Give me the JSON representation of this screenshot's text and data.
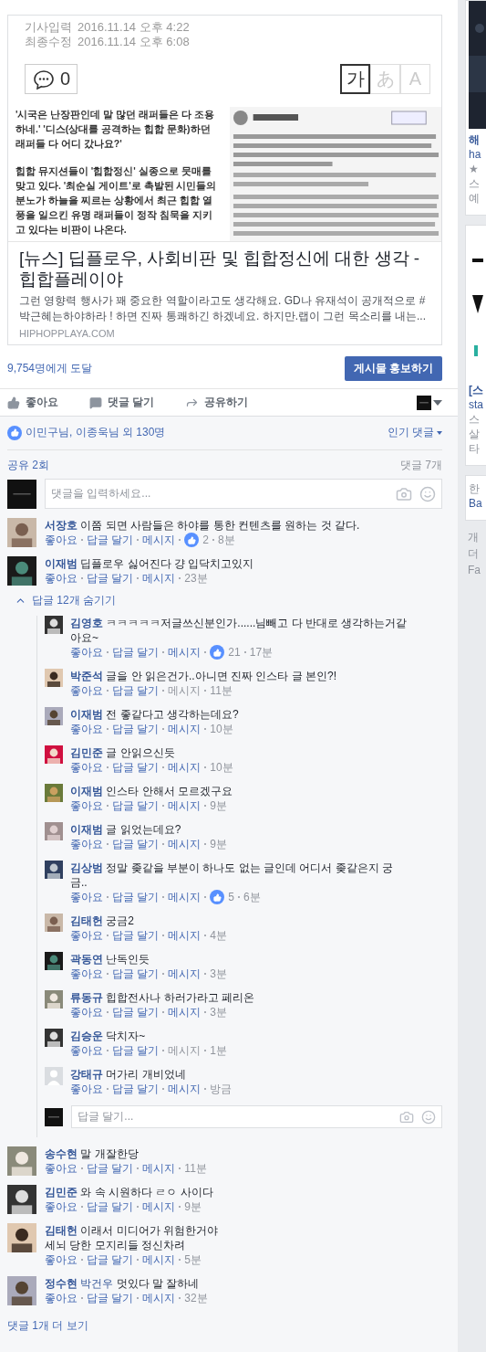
{
  "link_preview": {
    "article_dates": [
      {
        "label": "기사입력",
        "value": "2016.11.14 오후 4:22"
      },
      {
        "label": "최종수정",
        "value": "2016.11.14 오후 6:08"
      }
    ],
    "comment_count": "0",
    "font_options": [
      {
        "label": "가",
        "selected": true
      },
      {
        "label": "あ",
        "selected": false
      },
      {
        "label": "A",
        "selected": false
      }
    ],
    "article_text": [
      "'시국은 난장판인데 말 많던 래퍼들은 다 조용하네.' '디스(상대를 공격하는 힙합 문화)하던 래퍼들 다 어디 갔나요?'",
      "힙합 뮤지션들이 '힙합정신' 실종으로 뭇매를 맞고 있다. '최순실 게이트'로 촉발된 시민들의 분노가 하늘을 찌르는 상황에서 최근 힙합 열풍을 일으킨 유명 래퍼들이 정작 침묵을 지키고 있다는 비판이 나온다."
    ],
    "embedded_image": {
      "kind": "picture"
    },
    "title": "[뉴스] 딥플로우, 사회비판 및 힙합정신에 대한 생각 - 힙합플레이야",
    "description": "그런 영향력 행사가 꽤 중요한 역할이라고도 생각해요. GD나 유재석이 공개적으로 #박근혜는하야하라 ! 하면 진짜 통쾌하긴 하겠네요. 하지만.랩이 그런 목소리를 내는...",
    "domain": "HIPHOPPLAYA.COM"
  },
  "reach": "9,754명에게 도달",
  "promote_button": "게시물 홍보하기",
  "actions": [
    {
      "kind": "like",
      "label": "좋아요"
    },
    {
      "kind": "comment",
      "label": "댓글 달기"
    },
    {
      "kind": "share",
      "label": "공유하기"
    }
  ],
  "likes_summary": "이민구님, 이종욱님 외 130명",
  "sort": "인기 댓글",
  "shares": "공유 2회",
  "comment_total": "댓글 7개",
  "comment_placeholder": "댓글을 입력하세요...",
  "comments": [
    {
      "default_avatar": false,
      "actions": {
        "like": "좋아요",
        "reply": "답글 달기",
        "message": "메시지"
      },
      "name": "서장호",
      "text": "이쯤 되면 사람들은 하야를 통한 컨텐츠를 원하는 것 같다.",
      "message_enabled": true,
      "likes": "2",
      "time": "8분"
    },
    {
      "default_avatar": false,
      "actions": {
        "like": "좋아요",
        "reply": "답글 달기",
        "message": "메시지"
      },
      "name": "이재범",
      "text": "딥플로우 싫어진다 걍 입닥치고있지",
      "message_enabled": true,
      "time": "23분",
      "replies": {
        "toggle": "답글 12개 숨기기",
        "expanded": true,
        "placeholder": "답글 달기...",
        "items": [
          {
            "default_avatar": false,
            "actions": {
              "like": "좋아요",
              "reply": "답글 달기",
              "message": "메시지"
            },
            "name": "김영호",
            "text": "ㅋㅋㅋㅋㅋ저글쓰신분인가......님빼고 다 반대로 생각하는거같아요~",
            "message_enabled": true,
            "likes": "21",
            "time": "17분"
          },
          {
            "default_avatar": false,
            "actions": {
              "like": "좋아요",
              "reply": "답글 달기",
              "message": "메시지"
            },
            "name": "박준석",
            "text": "글을 안 읽은건가..아니면 진짜 인스타 글 본인?!",
            "message_enabled": false,
            "time": "11분"
          },
          {
            "default_avatar": false,
            "actions": {
              "like": "좋아요",
              "reply": "답글 달기",
              "message": "메시지"
            },
            "name": "이재범",
            "text": "전 좋같다고 생각하는데요?",
            "message_enabled": true,
            "time": "10분"
          },
          {
            "default_avatar": false,
            "actions": {
              "like": "좋아요",
              "reply": "답글 달기",
              "message": "메시지"
            },
            "name": "김민준",
            "text": "글 안읽으신듯",
            "message_enabled": true,
            "time": "10분"
          },
          {
            "default_avatar": false,
            "actions": {
              "like": "좋아요",
              "reply": "답글 달기",
              "message": "메시지"
            },
            "name": "이재범",
            "text": "인스타 안해서 모르겠구요",
            "message_enabled": true,
            "time": "9분"
          },
          {
            "default_avatar": false,
            "actions": {
              "like": "좋아요",
              "reply": "답글 달기",
              "message": "메시지"
            },
            "name": "이재범",
            "text": "글 읽었는데요?",
            "message_enabled": true,
            "time": "9분"
          },
          {
            "default_avatar": false,
            "actions": {
              "like": "좋아요",
              "reply": "답글 달기",
              "message": "메시지"
            },
            "name": "김상범",
            "text": "정말 좆같을 부분이 하나도 없는 글인데 어디서 좆같은지 궁금..",
            "message_enabled": true,
            "likes": "5",
            "time": "6분"
          },
          {
            "default_avatar": false,
            "actions": {
              "like": "좋아요",
              "reply": "답글 달기",
              "message": "메시지"
            },
            "name": "김태헌",
            "text": "궁금2",
            "message_enabled": true,
            "time": "4분"
          },
          {
            "default_avatar": false,
            "actions": {
              "like": "좋아요",
              "reply": "답글 달기",
              "message": "메시지"
            },
            "name": "곽동연",
            "text": "난독인듯",
            "message_enabled": true,
            "time": "3분"
          },
          {
            "default_avatar": false,
            "actions": {
              "like": "좋아요",
              "reply": "답글 달기",
              "message": "메시지"
            },
            "name": "류동규",
            "text": "힙합전사나 하러가라고 페리온",
            "message_enabled": true,
            "time": "3분"
          },
          {
            "default_avatar": false,
            "actions": {
              "like": "좋아요",
              "reply": "답글 달기",
              "message": "메시지"
            },
            "name": "김승운",
            "text": "닥치자~",
            "message_enabled": false,
            "time": "1분"
          },
          {
            "default_avatar": true,
            "actions": {
              "like": "좋아요",
              "reply": "답글 달기",
              "message": "메시지"
            },
            "name": "강태규",
            "text": "머가리 개비었네",
            "message_enabled": true,
            "time": "방금"
          }
        ]
      }
    },
    {
      "default_avatar": false,
      "actions": {
        "like": "좋아요",
        "reply": "답글 달기",
        "message": "메시지"
      },
      "name": "송수현",
      "text": "말 개잘한당",
      "message_enabled": true,
      "time": "11분"
    },
    {
      "default_avatar": false,
      "actions": {
        "like": "좋아요",
        "reply": "답글 달기",
        "message": "메시지"
      },
      "name": "김민준",
      "text": "와 속 시원하다 ㄹㅇ 사이다",
      "message_enabled": true,
      "time": "9분"
    },
    {
      "default_avatar": false,
      "actions": {
        "like": "좋아요",
        "reply": "답글 달기",
        "message": "메시지"
      },
      "name": "김태헌",
      "text": "이래서 미디어가 위험한거야\n세뇌 당한 모지리들 정신차려",
      "message_enabled": true,
      "time": "5분"
    },
    {
      "default_avatar": false,
      "actions": {
        "like": "좋아요",
        "reply": "답글 달기",
        "message": "메시지"
      },
      "name": "정수현",
      "tag": "박건우",
      "text": "멋있다 말 잘하네",
      "message_enabled": true,
      "time": "32분"
    }
  ],
  "more_comments": "댓글 1개 더 보기",
  "sidebar": {
    "cards": [
      {
        "texts": [
          {
            "kind": "title",
            "text": "해"
          },
          {
            "kind": "link",
            "text": "ha"
          },
          {
            "kind": "meta",
            "text": "★"
          },
          {
            "kind": "meta",
            "text": "스"
          },
          {
            "kind": "meta",
            "text": "예"
          }
        ]
      },
      {
        "texts": [
          {
            "kind": "title",
            "text": "[스"
          },
          {
            "kind": "link",
            "text": "sta"
          },
          {
            "kind": "meta",
            "text": "스"
          },
          {
            "kind": "meta",
            "text": "살"
          },
          {
            "kind": "meta",
            "text": "타"
          }
        ]
      },
      {
        "texts": [
          {
            "kind": "meta",
            "text": "한"
          },
          {
            "kind": "link",
            "text": "Ba"
          }
        ]
      }
    ],
    "footer": [
      "개",
      "더",
      "Fa"
    ]
  }
}
